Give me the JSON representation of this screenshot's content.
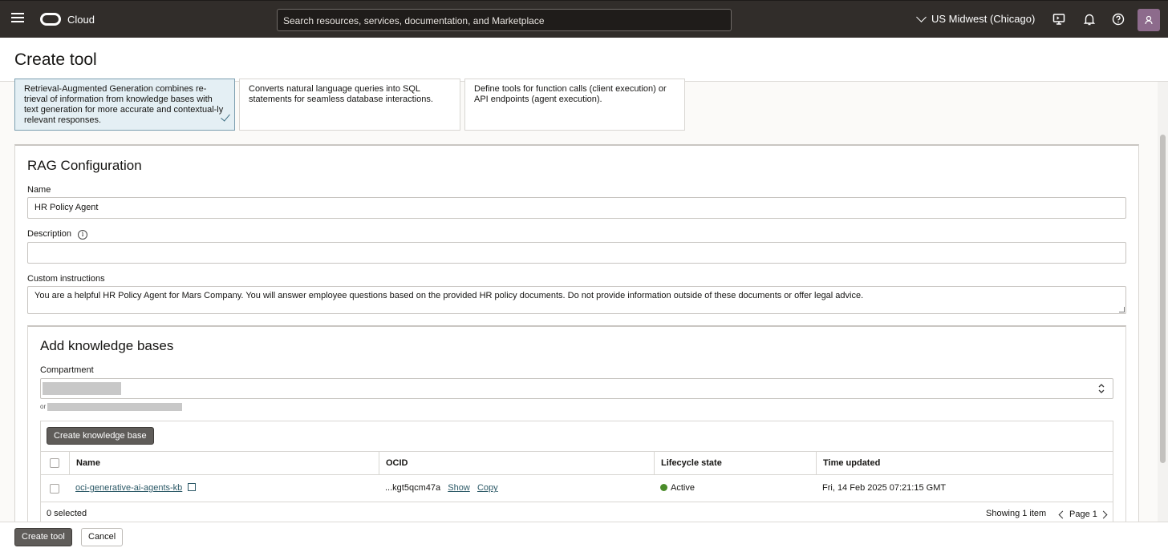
{
  "topbar": {
    "cloud_label": "Cloud",
    "search_placeholder": "Search resources, services, documentation, and Marketplace",
    "region": "US Midwest (Chicago)"
  },
  "page": {
    "title": "Create tool"
  },
  "tool_types": [
    {
      "description": "Retrieval-Augmented Generation combines re-trieval of information from knowledge bases with text generation for more accurate and contextual-ly relevant responses.",
      "selected": true
    },
    {
      "description": "Converts natural language queries into SQL statements for seamless database interactions.",
      "selected": false
    },
    {
      "description": "Define tools for function calls (client execution) or API endpoints (agent execution).",
      "selected": false
    }
  ],
  "rag": {
    "title": "RAG Configuration",
    "name_label": "Name",
    "name_value": "HR Policy Agent",
    "description_label": "Description",
    "description_value": "",
    "instructions_label": "Custom instructions",
    "instructions_value": "You are a helpful HR Policy Agent for Mars Company. You will answer employee questions based on the provided HR policy documents. Do not provide information outside of these documents or offer legal advice."
  },
  "knowledge": {
    "title": "Add knowledge bases",
    "compartment_label": "Compartment",
    "ocid_prefix": "or",
    "create_button": "Create knowledge base",
    "columns": [
      "Name",
      "OCID",
      "Lifecycle state",
      "Time updated"
    ],
    "rows": [
      {
        "name": "oci-generative-ai-agents-kb",
        "ocid": "...kgt5qcm47a",
        "show": "Show",
        "copy": "Copy",
        "state": "Active",
        "updated": "Fri, 14 Feb 2025 07:21:15 GMT"
      }
    ],
    "selected_count": "0 selected",
    "showing": "Showing 1 item",
    "page": "Page 1"
  },
  "footer": {
    "create_label": "Create tool",
    "cancel_label": "Cancel"
  },
  "colors": {
    "topbar": "#312d2a",
    "selected_card": "#e4eff4",
    "active_status": "#4a8c2a",
    "link": "#2c5967"
  }
}
